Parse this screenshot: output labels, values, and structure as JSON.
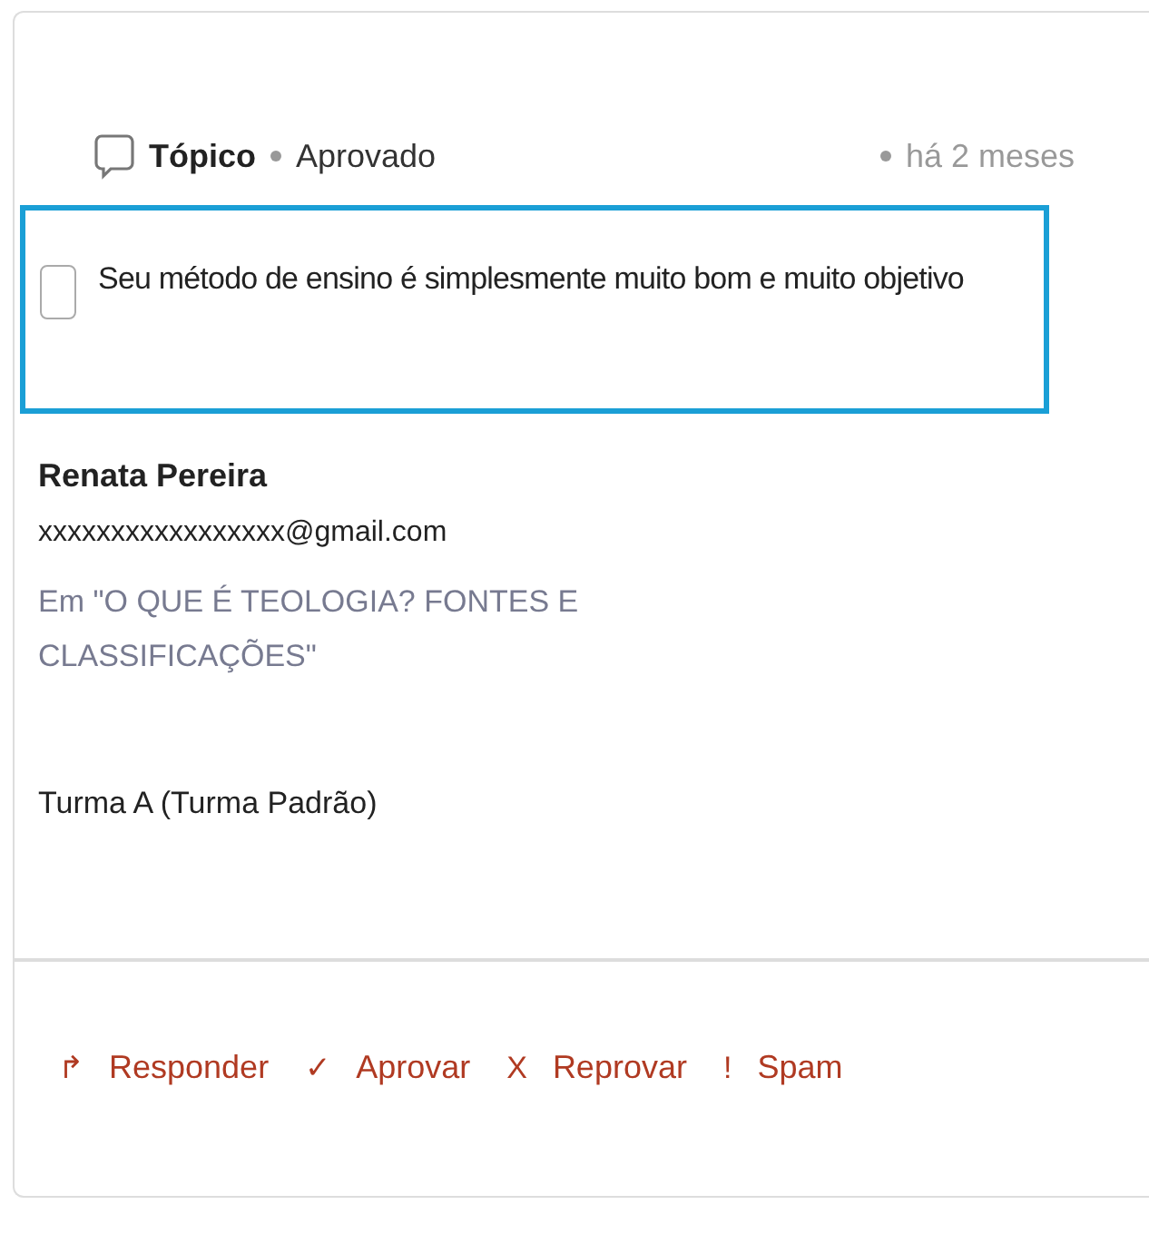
{
  "header": {
    "type": "Tópico",
    "status": "Aprovado",
    "time": "há 2 meses"
  },
  "comment": {
    "selected": true,
    "checked": false,
    "text": "Seu método de ensino é simplesmente muito bom e muito objetivo"
  },
  "author": {
    "name": "Renata Pereira",
    "email": "xxxxxxxxxxxxxxxxx@gmail.com"
  },
  "context": "Em \"O QUE É TEOLOGIA? FONTES E CLASSIFICAÇÕES\"",
  "group": "Turma A (Turma Padrão)",
  "actions": [
    {
      "icon": "↱",
      "label": "Responder"
    },
    {
      "icon": "✓",
      "label": "Aprovar"
    },
    {
      "icon": "X",
      "label": "Reprovar"
    },
    {
      "icon": "!",
      "label": "Spam"
    }
  ]
}
